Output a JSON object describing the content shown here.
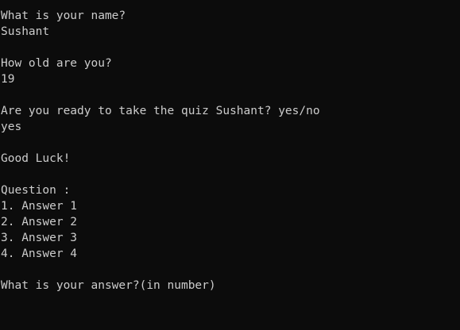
{
  "console": {
    "name_prompt": "What is your name?",
    "name_input": "Sushant",
    "age_prompt": "How old are you?",
    "age_input": "19",
    "ready_prompt": "Are you ready to take the quiz Sushant? yes/no",
    "ready_input": "yes",
    "good_luck": "Good Luck!",
    "question_label": "Question :",
    "answers": [
      "1. Answer 1",
      "2. Answer 2",
      "3. Answer 3",
      "4. Answer 4"
    ],
    "answer_prompt": "What is your answer?(in number)"
  }
}
